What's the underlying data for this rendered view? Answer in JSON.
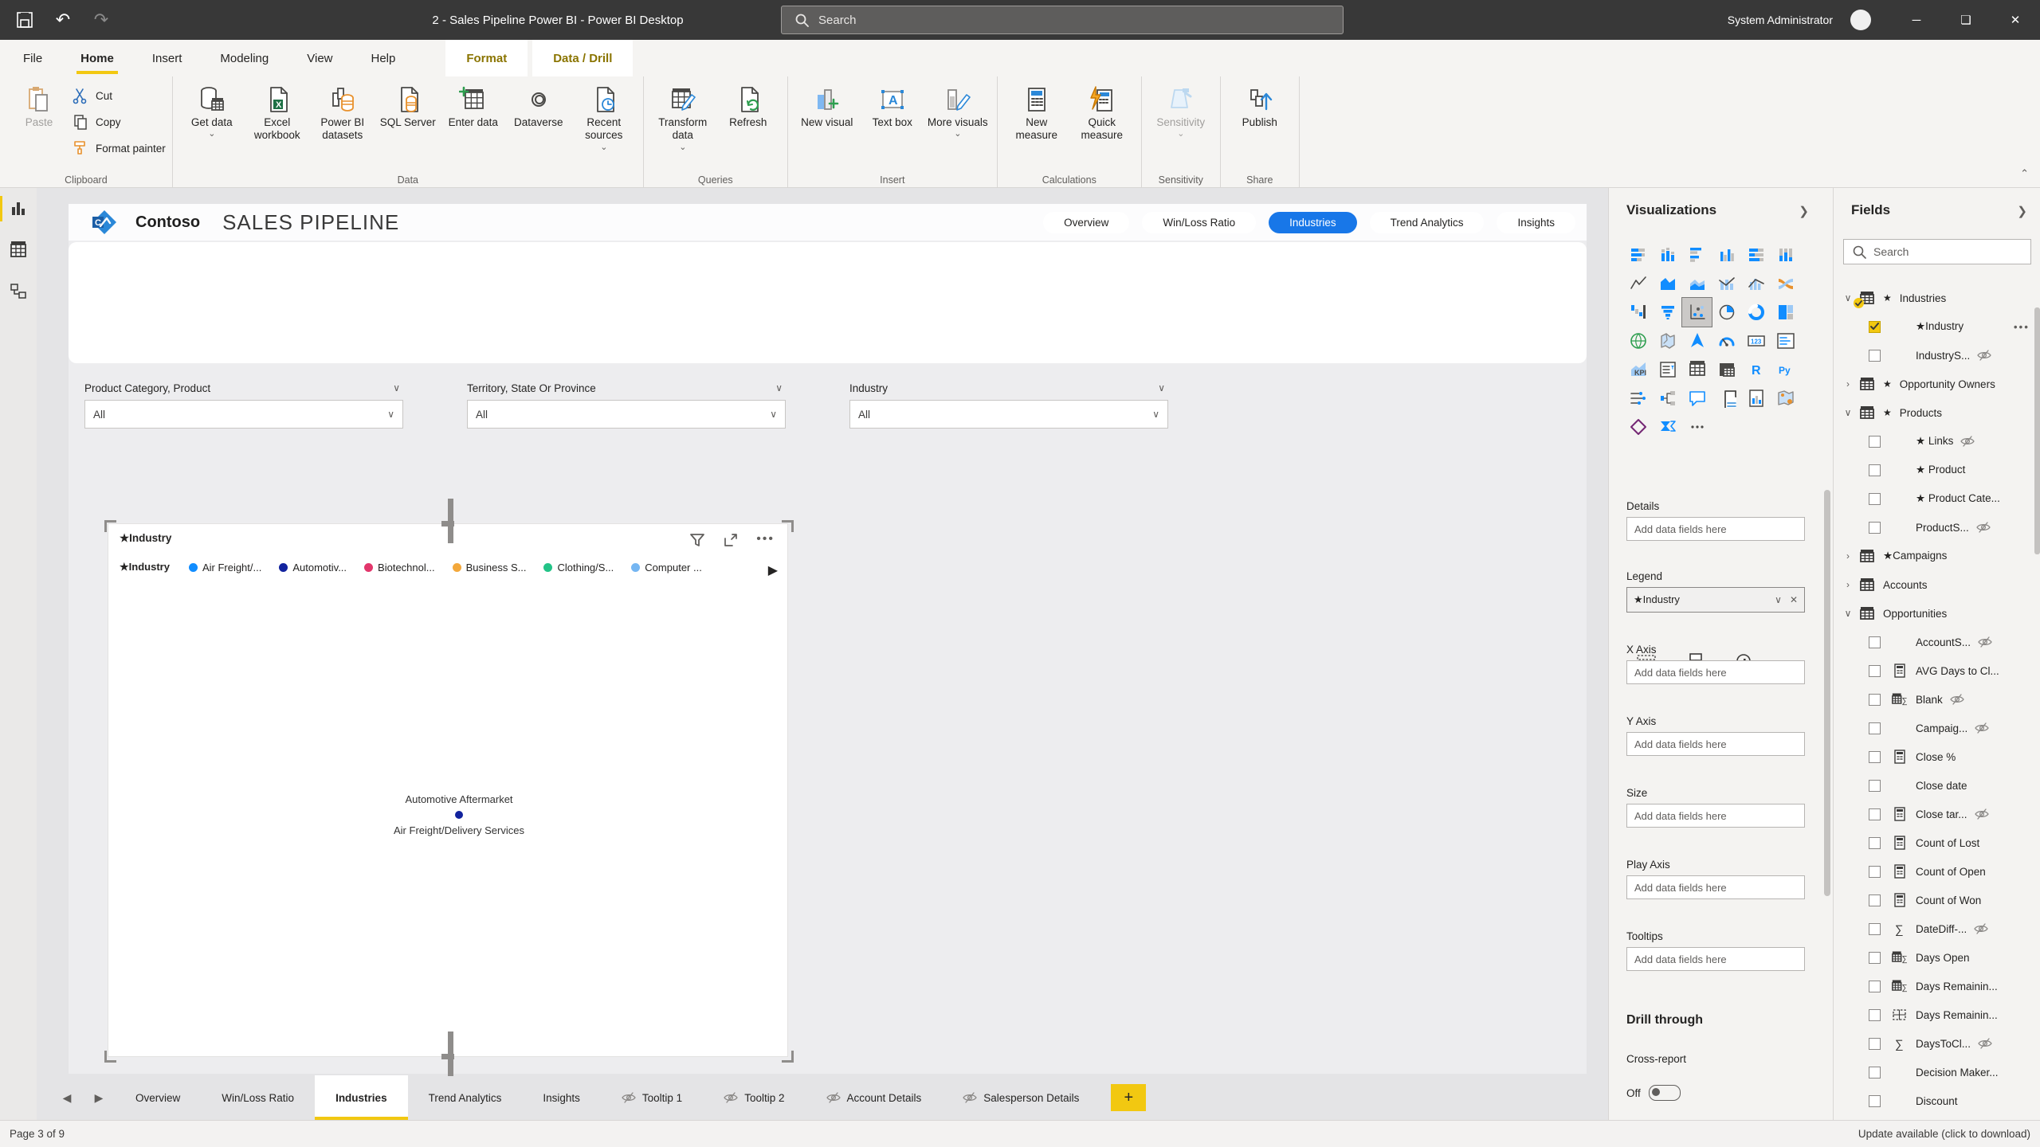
{
  "titlebar": {
    "title": "2 - Sales Pipeline Power BI - Power BI Desktop",
    "search_placeholder": "Search",
    "user": "System Administrator",
    "icons": [
      "save-icon",
      "undo-icon",
      "redo-icon",
      "search-icon",
      "avatar",
      "minimize-icon",
      "restore-icon",
      "close-icon"
    ]
  },
  "ribbon": {
    "tabs": [
      {
        "label": "File"
      },
      {
        "label": "Home",
        "active": true
      },
      {
        "label": "Insert"
      },
      {
        "label": "Modeling"
      },
      {
        "label": "View"
      },
      {
        "label": "Help"
      }
    ],
    "contextual_tabs": [
      {
        "label": "Format"
      },
      {
        "label": "Data / Drill"
      }
    ],
    "groups": [
      {
        "label": "Clipboard",
        "buttons": [
          {
            "label": "Paste",
            "icon": "paste-icon",
            "big": true,
            "disabled": true
          },
          {
            "label": "Cut",
            "icon": "cut-icon",
            "small": true
          },
          {
            "label": "Copy",
            "icon": "copy-icon",
            "small": true
          },
          {
            "label": "Format painter",
            "icon": "format-painter-icon",
            "small": true
          }
        ]
      },
      {
        "label": "Data",
        "buttons": [
          {
            "label": "Get data",
            "icon": "get-data-icon",
            "arrow": true
          },
          {
            "label": "Excel workbook",
            "icon": "excel-workbook-icon"
          },
          {
            "label": "Power BI datasets",
            "icon": "power-bi-datasets-icon"
          },
          {
            "label": "SQL Server",
            "icon": "sql-server-icon"
          },
          {
            "label": "Enter data",
            "icon": "enter-data-icon"
          },
          {
            "label": "Dataverse",
            "icon": "dataverse-icon"
          },
          {
            "label": "Recent sources",
            "icon": "recent-sources-icon",
            "arrow": true
          }
        ]
      },
      {
        "label": "Queries",
        "buttons": [
          {
            "label": "Transform data",
            "icon": "transform-data-icon",
            "arrow": true
          },
          {
            "label": "Refresh",
            "icon": "refresh-icon"
          }
        ]
      },
      {
        "label": "Insert",
        "buttons": [
          {
            "label": "New visual",
            "icon": "new-visual-icon"
          },
          {
            "label": "Text box",
            "icon": "text-box-icon"
          },
          {
            "label": "More visuals",
            "icon": "more-visuals-icon",
            "arrow": true
          }
        ]
      },
      {
        "label": "Calculations",
        "buttons": [
          {
            "label": "New measure",
            "icon": "new-measure-icon"
          },
          {
            "label": "Quick measure",
            "icon": "quick-measure-icon"
          }
        ]
      },
      {
        "label": "Sensitivity",
        "buttons": [
          {
            "label": "Sensitivity",
            "icon": "sensitivity-icon",
            "arrow": true,
            "disabled": true
          }
        ]
      },
      {
        "label": "Share",
        "buttons": [
          {
            "label": "Publish",
            "icon": "publish-icon"
          }
        ]
      }
    ]
  },
  "view_rail": {
    "items": [
      {
        "name": "report-view",
        "active": true
      },
      {
        "name": "data-view"
      },
      {
        "name": "model-view"
      }
    ]
  },
  "report": {
    "brand": "Contoso",
    "title": "SALES PIPELINE",
    "nav": [
      {
        "label": "Overview"
      },
      {
        "label": "Win/Loss Ratio"
      },
      {
        "label": "Industries",
        "active": true
      },
      {
        "label": "Trend Analytics"
      },
      {
        "label": "Insights"
      }
    ],
    "filters": [
      {
        "label": "Product Category, Product",
        "value": "All"
      },
      {
        "label": "Territory, State Or Province",
        "value": "All"
      },
      {
        "label": "Industry",
        "value": "All"
      }
    ],
    "visual": {
      "title": "★Industry",
      "header_icons": [
        "filter-icon",
        "focus-mode-icon",
        "more-options-icon"
      ],
      "legend_label": "★Industry",
      "legend": [
        {
          "label": "Air Freight/...",
          "color": "#118DFF"
        },
        {
          "label": "Automotiv...",
          "color": "#12239E"
        },
        {
          "label": "Biotechnol...",
          "color": "#E2366B"
        },
        {
          "label": "Business S...",
          "color": "#F3A83B"
        },
        {
          "label": "Clothing/S...",
          "color": "#23C387"
        },
        {
          "label": "Computer ...",
          "color": "#75B6F2"
        }
      ],
      "data_point": {
        "labels": [
          "Automotive Aftermarket",
          "Air Freight/Delivery Services"
        ],
        "color": "#12239E"
      }
    }
  },
  "visualizations_pane": {
    "title": "Visualizations",
    "selected_icon": "scatter-chart",
    "icons": [
      "stacked-bar-chart",
      "stacked-column-chart",
      "clustered-bar-chart",
      "clustered-column-chart",
      "hundred-stacked-bar-chart",
      "hundred-stacked-column-chart",
      "line-chart",
      "area-chart",
      "stacked-area-chart",
      "line-stacked-column-chart",
      "line-clustered-column-chart",
      "ribbon-chart",
      "waterfall-chart",
      "funnel-chart",
      "scatter-chart",
      "pie-chart",
      "donut-chart",
      "treemap",
      "map",
      "filled-map",
      "azure-map",
      "gauge",
      "card",
      "multi-row-card",
      "kpi",
      "slicer",
      "table",
      "matrix",
      "r-script-visual",
      "python-visual",
      "key-influencers",
      "decomposition-tree",
      "q-and-a",
      "smart-narrative",
      "paginated-report",
      "arcgis-map",
      "power-apps",
      "power-automate",
      "more-options"
    ],
    "tabs": [
      "fields-tab",
      "format-tab",
      "analytics-tab"
    ],
    "wells": [
      {
        "label": "Details",
        "placeholder": "Add data fields here"
      },
      {
        "label": "Legend",
        "value": "★Industry"
      },
      {
        "label": "X Axis",
        "placeholder": "Add data fields here"
      },
      {
        "label": "Y Axis",
        "placeholder": "Add data fields here"
      },
      {
        "label": "Size",
        "placeholder": "Add data fields here"
      },
      {
        "label": "Play Axis",
        "placeholder": "Add data fields here"
      },
      {
        "label": "Tooltips",
        "placeholder": "Add data fields here"
      }
    ],
    "drill_through": {
      "header": "Drill through",
      "cross_report_label": "Cross-report",
      "toggle_label": "Off",
      "toggle_state": "off"
    }
  },
  "fields_pane": {
    "title": "Fields",
    "search_placeholder": "Search",
    "tree": [
      {
        "type": "table",
        "label": "Industries",
        "star": true,
        "expanded": true,
        "checked_badge": true
      },
      {
        "type": "field",
        "label": "★Industry",
        "checked": true,
        "more": true
      },
      {
        "type": "field",
        "label": "IndustryS...",
        "hidden": true
      },
      {
        "type": "table",
        "label": "Opportunity Owners",
        "star": true
      },
      {
        "type": "table",
        "label": "Products",
        "star": true,
        "expanded": true
      },
      {
        "type": "field",
        "label": "★ Links",
        "hidden": true
      },
      {
        "type": "field",
        "label": "★ Product"
      },
      {
        "type": "field",
        "label": "★ Product Cate..."
      },
      {
        "type": "field",
        "label": "ProductS...",
        "hidden": true
      },
      {
        "type": "table",
        "label": "★Campaigns"
      },
      {
        "type": "table",
        "label": "Accounts"
      },
      {
        "type": "table",
        "label": "Opportunities",
        "expanded": true
      },
      {
        "type": "field",
        "label": "AccountS...",
        "hidden": true
      },
      {
        "type": "field",
        "label": "AVG Days to Cl...",
        "icon": "measure-icon"
      },
      {
        "type": "field",
        "label": "Blank",
        "icon": "table-sum-icon",
        "hidden": true
      },
      {
        "type": "field",
        "label": "Campaig...",
        "hidden": true
      },
      {
        "type": "field",
        "label": "Close %",
        "icon": "measure-icon"
      },
      {
        "type": "field",
        "label": "Close date"
      },
      {
        "type": "field",
        "label": "Close tar...",
        "icon": "measure-icon",
        "hidden": true
      },
      {
        "type": "field",
        "label": "Count of Lost",
        "icon": "measure-icon"
      },
      {
        "type": "field",
        "label": "Count of Open",
        "icon": "measure-icon"
      },
      {
        "type": "field",
        "label": "Count of Won",
        "icon": "measure-icon"
      },
      {
        "type": "field",
        "label": "DateDiff-...",
        "icon": "sum-icon",
        "hidden": true
      },
      {
        "type": "field",
        "label": "Days Open",
        "icon": "table-sum-icon"
      },
      {
        "type": "field",
        "label": "Days Remainin...",
        "icon": "table-sum-icon"
      },
      {
        "type": "field",
        "label": "Days Remainin...",
        "icon": "table-dashed-icon"
      },
      {
        "type": "field",
        "label": "DaysToCl...",
        "icon": "sum-icon",
        "hidden": true
      },
      {
        "type": "field",
        "label": "Decision Maker..."
      },
      {
        "type": "field",
        "label": "Discount"
      }
    ]
  },
  "page_tabs": {
    "items": [
      {
        "label": "Overview"
      },
      {
        "label": "Win/Loss Ratio"
      },
      {
        "label": "Industries",
        "active": true
      },
      {
        "label": "Trend Analytics"
      },
      {
        "label": "Insights"
      },
      {
        "label": "Tooltip 1",
        "hidden": true
      },
      {
        "label": "Tooltip 2",
        "hidden": true
      },
      {
        "label": "Account Details",
        "hidden": true
      },
      {
        "label": "Salesperson Details",
        "hidden": true
      }
    ],
    "add_label": "+"
  },
  "status_bar": {
    "left": "Page 3 of 9",
    "right": "Update available (click to download)"
  }
}
